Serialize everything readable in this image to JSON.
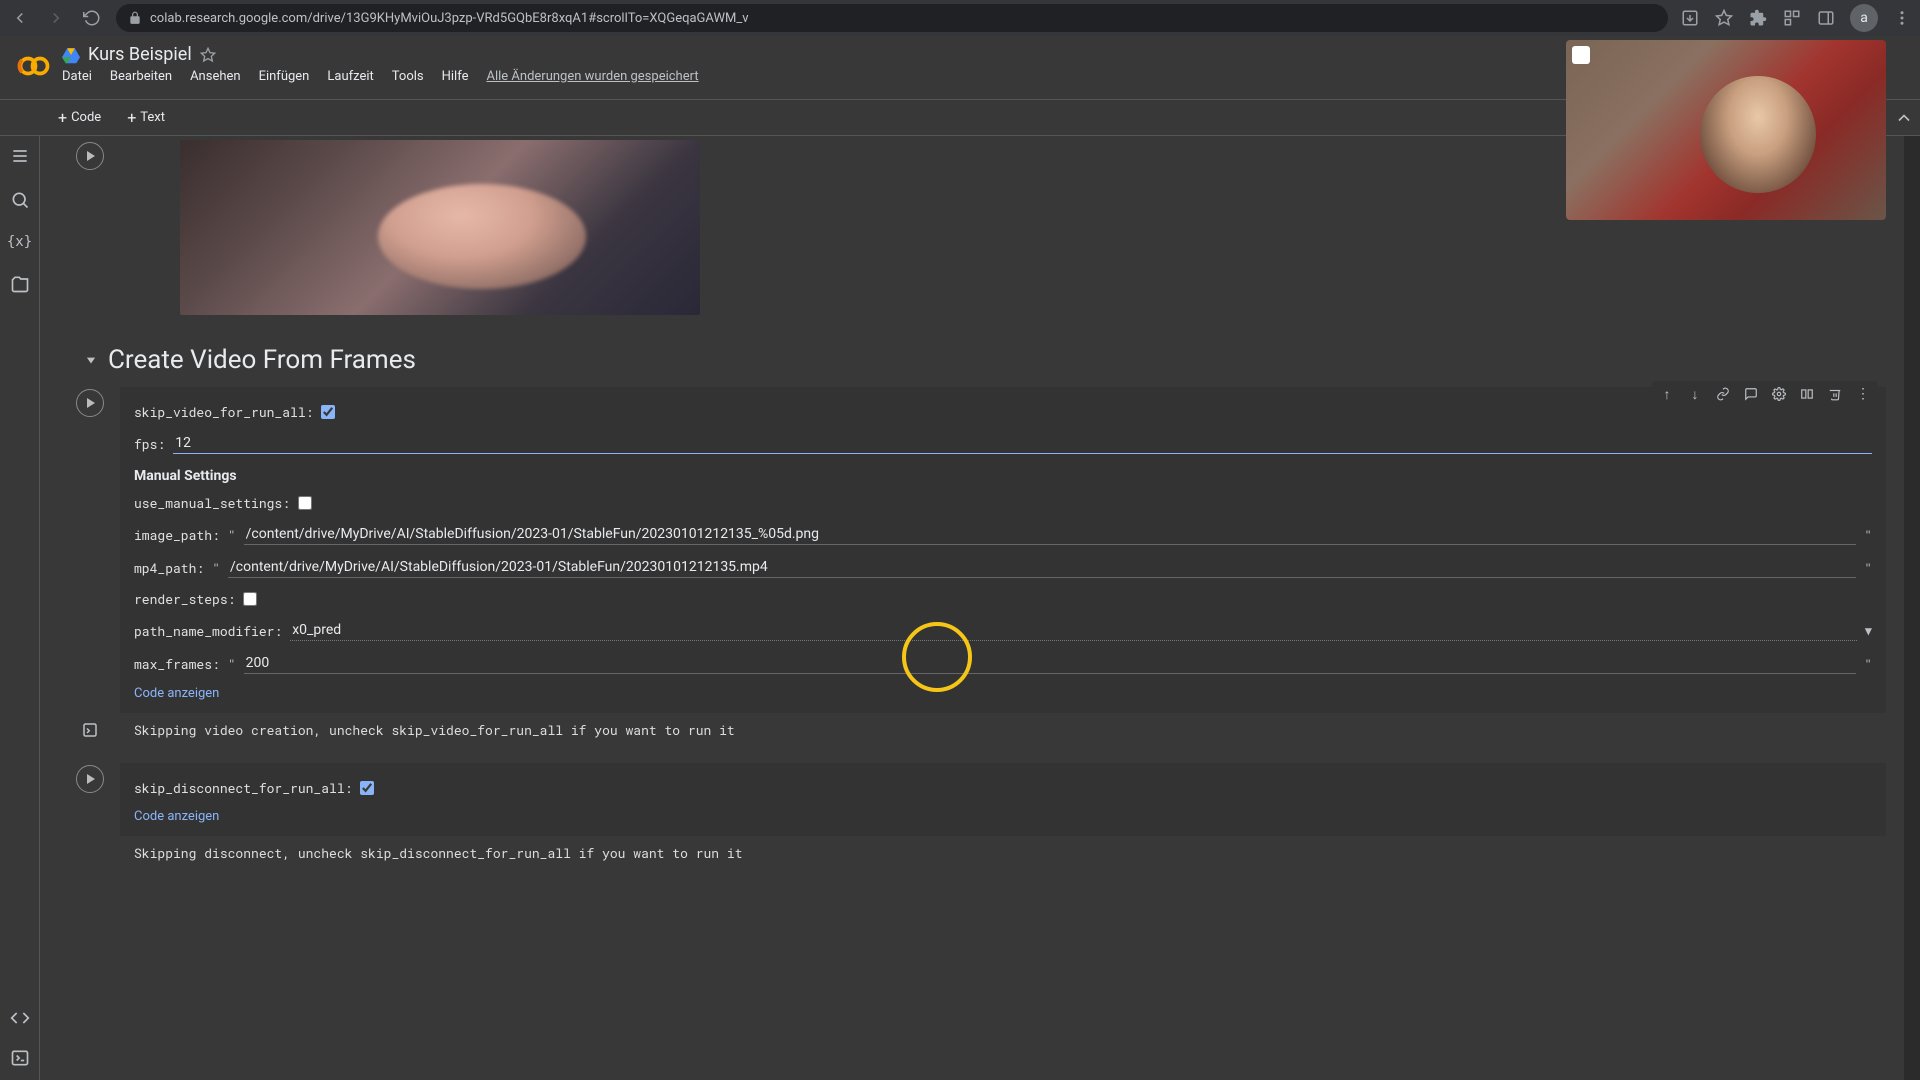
{
  "browser": {
    "url": "colab.research.google.com/drive/13G9KHyMviOuJ3pzp-VRd5GQbE8r8xqA1#scrollTo=XQGeqaGAWM_v"
  },
  "header": {
    "notebook_title": "Kurs Beispiel",
    "menus": {
      "file": "Datei",
      "edit": "Bearbeiten",
      "view": "Ansehen",
      "insert": "Einfügen",
      "runtime": "Laufzeit",
      "tools": "Tools",
      "help": "Hilfe",
      "saved": "Alle Änderungen wurden gespeichert"
    },
    "avatar_initial": "a"
  },
  "toolbar": {
    "code_label": "Code",
    "text_label": "Text"
  },
  "section": {
    "title": "Create Video From Frames"
  },
  "form1": {
    "skip_video_label": "skip_video_for_run_all:",
    "skip_video_checked": true,
    "fps_label": "fps:",
    "fps_value": "12",
    "manual_header": "Manual Settings",
    "use_manual_label": "use_manual_settings:",
    "use_manual_checked": false,
    "image_path_label": "image_path:",
    "image_path_value": "/content/drive/MyDrive/AI/StableDiffusion/2023-01/StableFun/20230101212135_%05d.png",
    "mp4_path_label": "mp4_path:",
    "mp4_path_value": "/content/drive/MyDrive/AI/StableDiffusion/2023-01/StableFun/20230101212135.mp4",
    "render_steps_label": "render_steps:",
    "render_steps_checked": false,
    "path_name_label": "path_name_modifier:",
    "path_name_value": "x0_pred",
    "max_frames_label": "max_frames:",
    "max_frames_value": "200",
    "show_code": "Code anzeigen"
  },
  "output1": "Skipping video creation, uncheck skip_video_for_run_all if you want to run it",
  "form2": {
    "skip_disconnect_label": "skip_disconnect_for_run_all:",
    "skip_disconnect_checked": true,
    "show_code": "Code anzeigen"
  },
  "output2": "Skipping disconnect, uncheck skip_disconnect_for_run_all if you want to run it"
}
